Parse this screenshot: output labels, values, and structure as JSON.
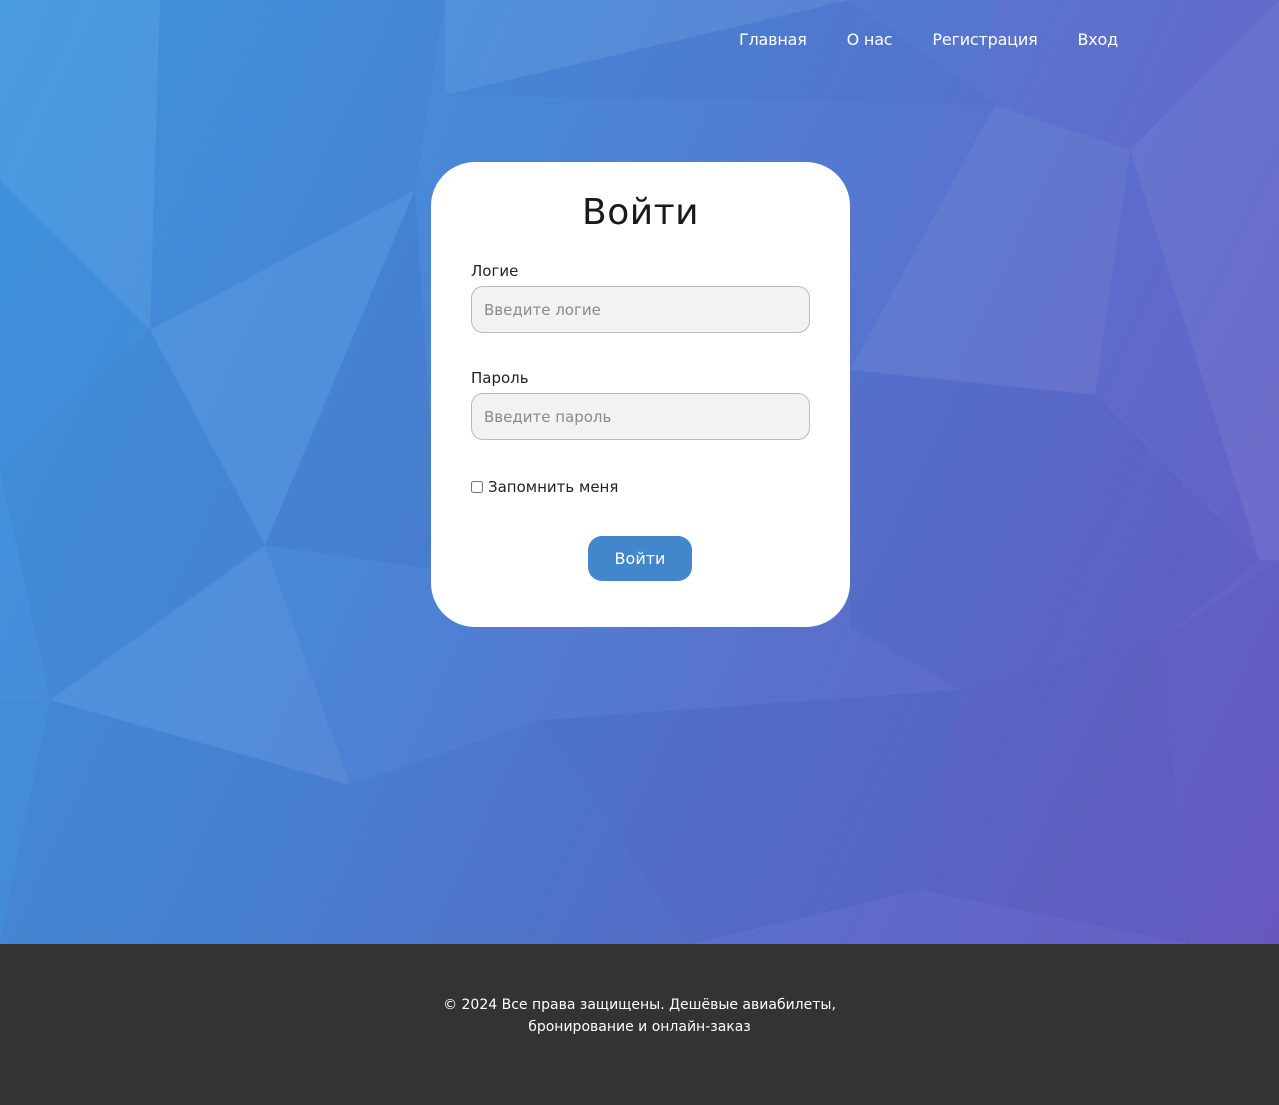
{
  "nav": {
    "items": [
      {
        "label": "Главная"
      },
      {
        "label": "О нас"
      },
      {
        "label": "Регистрация"
      },
      {
        "label": "Вход"
      }
    ]
  },
  "login_form": {
    "title": "Войти",
    "login_label": "Логие",
    "login_placeholder": "Введите логие",
    "login_value": "",
    "password_label": "Пароль",
    "password_placeholder": "Введите пароль",
    "password_value": "",
    "remember_label": "Запомнить меня",
    "remember_checked": false,
    "submit_label": "Войти"
  },
  "footer": {
    "line1": "© 2024 Все права защищены. Дешёвые авиабилеты,",
    "line2": "бронирование и онлайн-заказ"
  },
  "colors": {
    "accent": "#4286cc",
    "footer_bg": "#333333",
    "bg_start": "#4197e0",
    "bg_end": "#6a5cc4"
  }
}
